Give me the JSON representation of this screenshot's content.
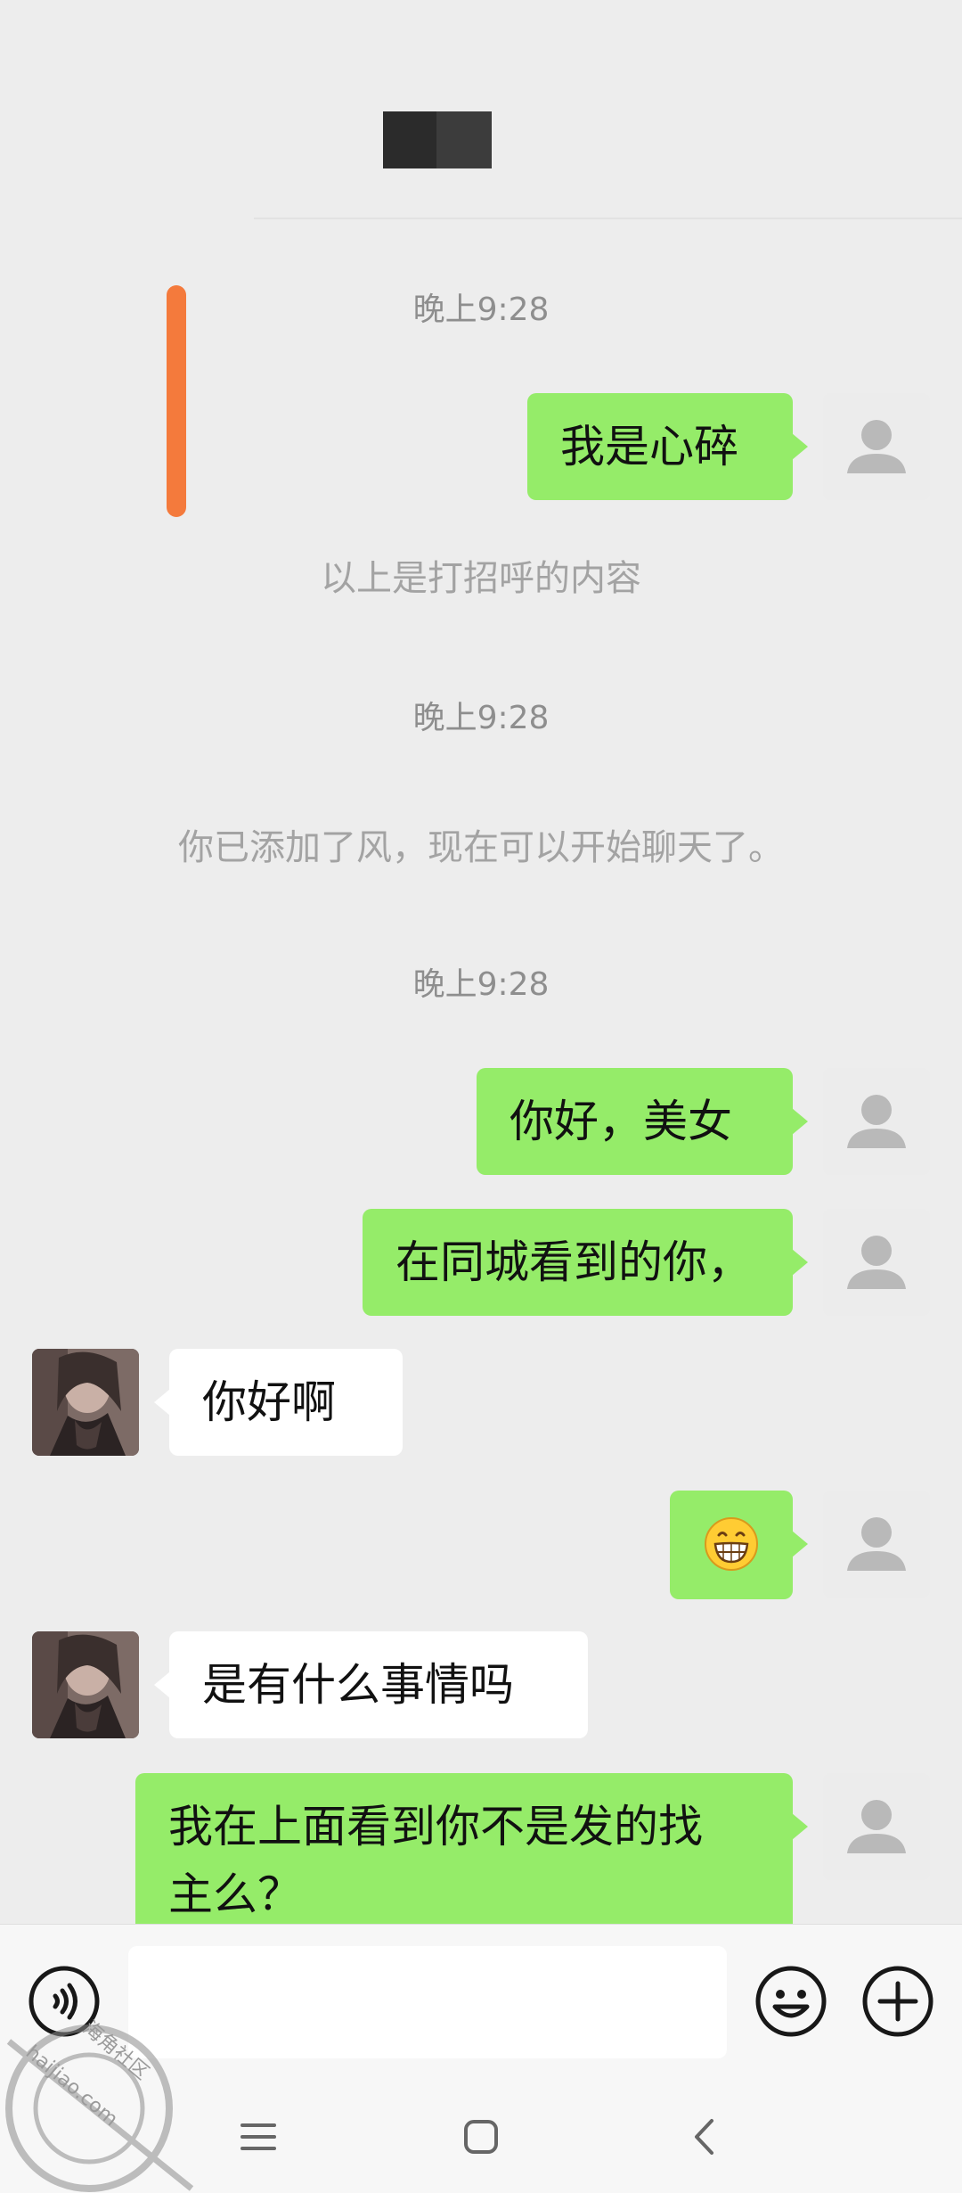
{
  "header": {
    "title_redacted": true
  },
  "timestamps": [
    "晚上9:28",
    "晚上9:28",
    "晚上9:28"
  ],
  "system_messages": {
    "greeting_notice": "以上是打招呼的内容",
    "added_notice": "你已添加了风，现在可以开始聊天了。"
  },
  "messages": [
    {
      "from": "me",
      "text": "我是心碎"
    },
    {
      "from": "me",
      "text": "你好，美女"
    },
    {
      "from": "me",
      "text": "在同城看到的你，"
    },
    {
      "from": "her",
      "text": "你好啊"
    },
    {
      "from": "me",
      "emoji": "grinning-face"
    },
    {
      "from": "her",
      "text": "是有什么事情吗"
    },
    {
      "from": "me",
      "lines": [
        "我在上面看到你不是发的找",
        "主么？"
      ]
    }
  ],
  "input_bar": {
    "voice_icon": "voice-icon",
    "emoji_icon": "emoji-icon",
    "more_icon": "plus-icon",
    "value": ""
  },
  "nav_bar": {
    "icons": [
      "menu-icon",
      "home-icon",
      "back-icon"
    ]
  },
  "watermark": {
    "line1": "海角社区",
    "line2": "haijiao.com"
  },
  "colors": {
    "background": "#ededed",
    "bubble_mine": "#95ec69",
    "bubble_theirs": "#ffffff",
    "marker": "#f47a3c"
  }
}
